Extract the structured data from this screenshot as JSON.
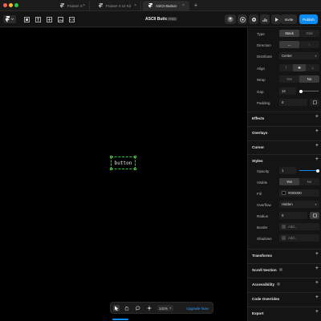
{
  "window": {
    "tabs": [
      {
        "label": "Framer X",
        "active": false
      },
      {
        "label": "Framer X UI Kit",
        "active": false
      },
      {
        "label": "ASCII Button",
        "active": true
      }
    ]
  },
  "toolbar": {
    "title": "ASCII Button",
    "badge": "FREE",
    "invite_label": "Invite",
    "publish_label": "Publish"
  },
  "canvas": {
    "element_text": "button",
    "zoom": "141%",
    "upgrade_label": "Upgrade Now"
  },
  "panel": {
    "type": {
      "label": "Type",
      "options": [
        "Stack",
        "Grid"
      ],
      "selected": "Stack"
    },
    "direction": {
      "label": "Direction",
      "options": [
        "↔",
        "↕"
      ],
      "selected": "↔"
    },
    "distribute": {
      "label": "Distribute",
      "value": "Center"
    },
    "align": {
      "label": "Align",
      "options": [
        "⊤",
        "✚",
        "⊥"
      ],
      "selected": "✚"
    },
    "wrap": {
      "label": "Wrap",
      "options": [
        "Yes",
        "No"
      ],
      "selected": "No"
    },
    "gap": {
      "label": "Gap",
      "value": "12"
    },
    "padding": {
      "label": "Padding",
      "value": "0"
    },
    "sections": {
      "effects": "Effects",
      "overlays": "Overlays",
      "cursor": "Cursor",
      "styles": "Styles",
      "transforms": "Transforms",
      "scroll_section": "Scroll Section",
      "accessibility": "Accessibility",
      "code_overrides": "Code Overrides",
      "export": "Export"
    },
    "styles": {
      "opacity": {
        "label": "Opacity",
        "value": "1"
      },
      "visible": {
        "label": "Visible",
        "options": [
          "Yes",
          "No"
        ],
        "selected": "Yes"
      },
      "fill": {
        "label": "Fill",
        "value": "#000000"
      },
      "overflow": {
        "label": "Overflow",
        "value": "Hidden"
      },
      "radius": {
        "label": "Radius",
        "value": "0"
      },
      "border": {
        "label": "Border",
        "value": "Add..."
      },
      "shadows": {
        "label": "Shadows",
        "value": "Add..."
      }
    }
  },
  "colors": {
    "accent": "#0d8bf2",
    "selection": "#3fbf3f",
    "traffic_red": "#ff5f57",
    "traffic_yellow": "#febc2e",
    "traffic_green": "#28c840"
  }
}
